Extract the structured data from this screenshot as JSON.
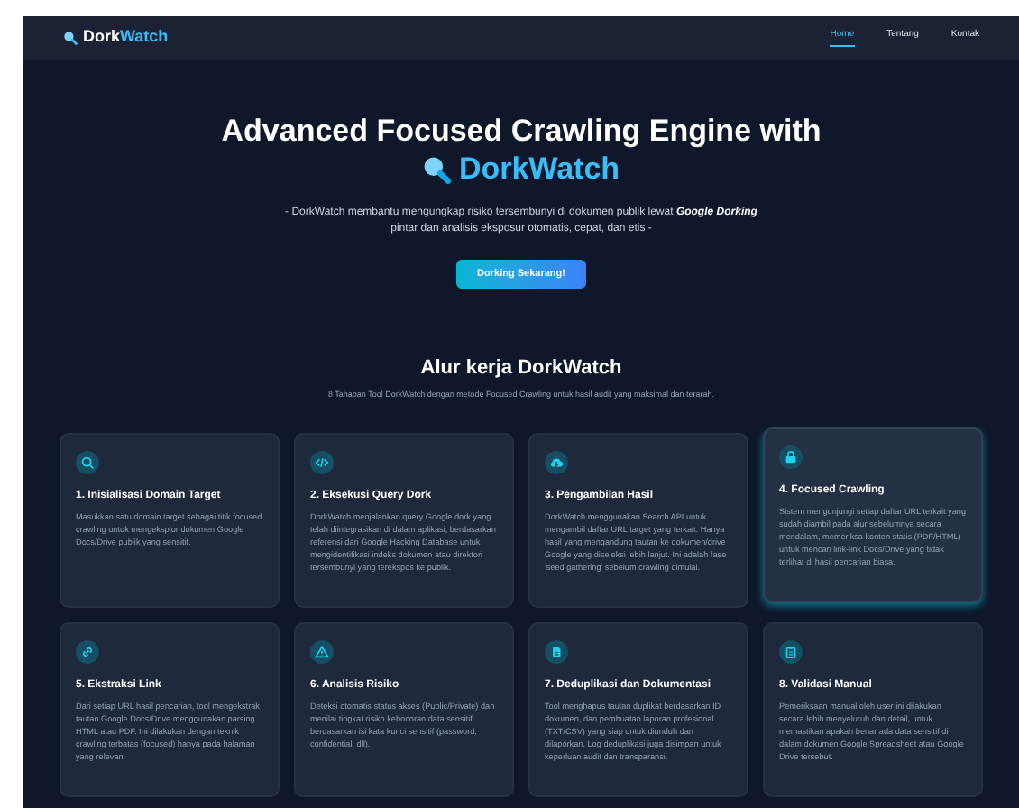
{
  "nav": {
    "brand_first": "Dork",
    "brand_second": "Watch",
    "links": [
      {
        "label": "Home",
        "selected": true
      },
      {
        "label": "Tentang",
        "selected": false
      },
      {
        "label": "Kontak",
        "selected": false
      }
    ]
  },
  "hero": {
    "title_line1": "Advanced Focused Crawling Engine with",
    "title_line2": "DorkWatch",
    "subtitle": "- DorkWatch membantu mengungkap risiko tersembunyi di dokumen publik lewat **Google Dorking** pintar dan analisis eksposur otomatis, cepat, dan etis -",
    "button": "Dorking Sekarang!"
  },
  "workflow": {
    "title": "Alur kerja DorkWatch",
    "subtitle": "8 Tahapan Tool DorkWatch dengan metode Focused Crawling untuk hasil audit yang maksimal dan terarah.",
    "cards": [
      {
        "title": "1. Inisialisasi Domain Target",
        "text": "Masukkan satu domain target sebagai titik focused crawling untuk mengeksplor dokumen Google Docs/Drive publik yang sensitif.",
        "highlighted": false
      },
      {
        "title": "2. Eksekusi Query Dork",
        "text": "DorkWatch menjalankan query Google dork yang telah diintegrasikan di dalam aplikasi, berdasarkan referensi dari Google Hacking Database untuk mengidentifikasi indeks dokumen atau direktori tersembunyi yang terekspos ke publik.",
        "highlighted": false
      },
      {
        "title": "3. Pengambilan Hasil",
        "text": "DorkWatch menggunakan Search API untuk mengambil daftar URL target yang terkait. Hanya hasil yang mengandung tautan ke dokumen/drive Google yang diseleksi lebih lanjut. Ini adalah fase 'seed gathering' sebelum crawling dimulai.",
        "highlighted": false
      },
      {
        "title": "4. Focused Crawling",
        "text": "Sistem mengunjungi setiap daftar URL terkait yang sudah diambil pada alur sebelumnya secara mendalam, memeriksa konten statis (PDF/HTML) untuk mencari link-link Docs/Drive yang tidak terlihat di hasil pencarian biasa.",
        "highlighted": true
      },
      {
        "title": "5. Ekstraksi Link",
        "text": "Dari setiap URL hasil pencarian, tool mengekstrak tautan Google Docs/Drive menggunakan parsing HTML atau PDF. Ini dilakukan dengan teknik crawling terbatas (focused) hanya pada halaman yang relevan.",
        "highlighted": false
      },
      {
        "title": "6. Analisis Risiko",
        "text": "Deteksi otomatis status akses (Public/Private) dan menilai tingkat risiko kebocoran data sensitif berdasarkan isi kata kunci sensitif (password, confidential, dll).",
        "highlighted": false
      },
      {
        "title": "7. Deduplikasi dan Dokumentasi",
        "text": "Tool menghapus tautan duplikat berdasarkan ID dokumen, dan pembuatan laporan profesional (TXT/CSV) yang siap untuk diunduh dan dilaporkan. Log deduplikasi juga disimpan untuk keperluan audit dan transparansi.",
        "highlighted": false
      },
      {
        "title": "8. Validasi Manual",
        "text": "Pemeriksaan manual oleh user ini dilakukan secara lebih menyeluruh dan detail, untuk memastikan apakah benar ada data sensitif di dalam dokumen Google Spreadsheet atau Google Drive tersebut.",
        "highlighted": false
      }
    ]
  }
}
